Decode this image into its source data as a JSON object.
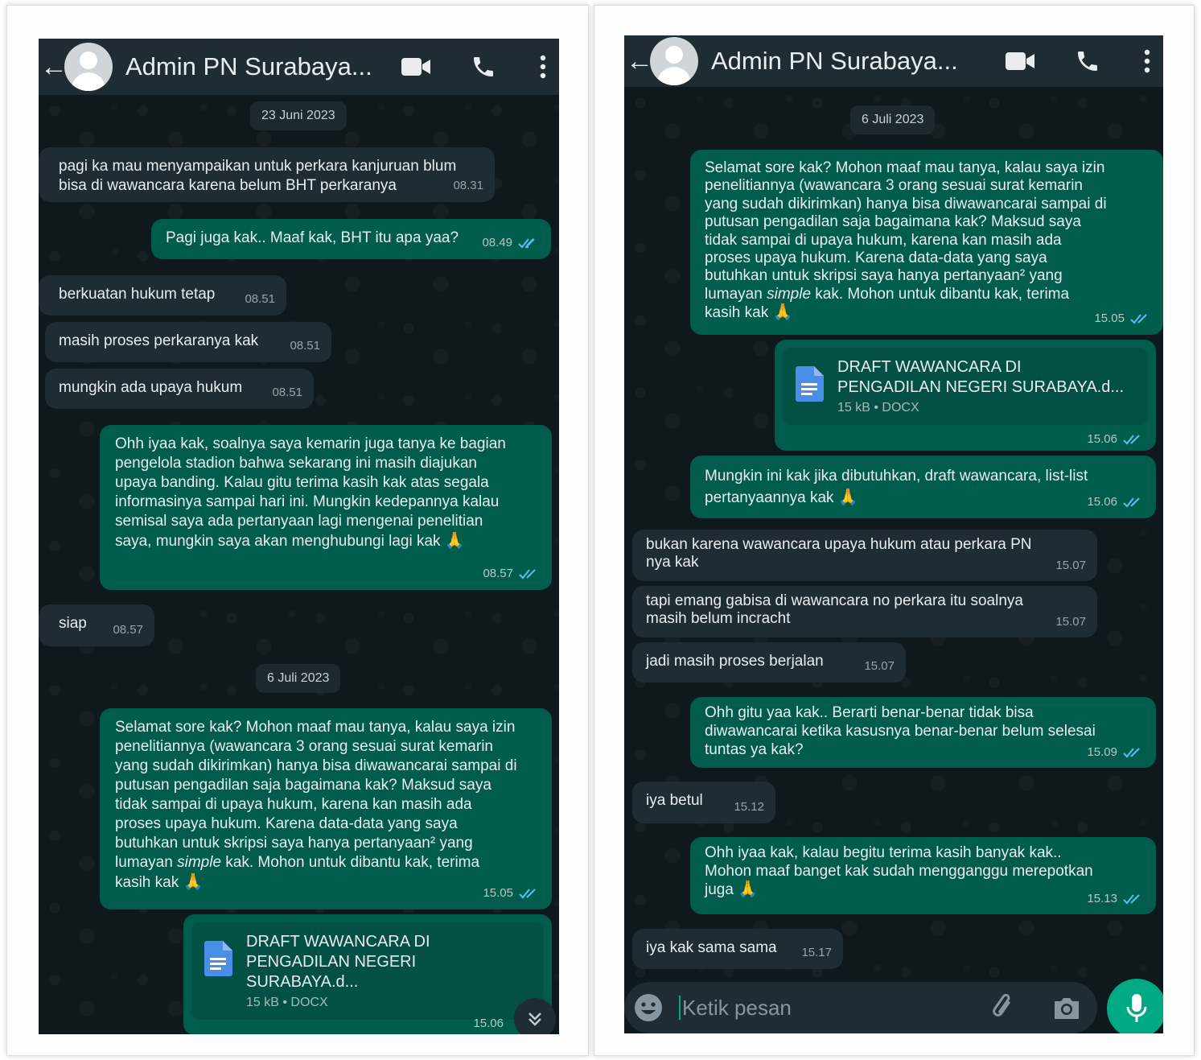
{
  "colors": {
    "header_bg": "#1f2c34",
    "chat_bg": "#0b141a",
    "bubble_in": "#1f2c34",
    "bubble_out": "#005c4b",
    "accent": "#00a884",
    "read_tick": "#53bdeb"
  },
  "left": {
    "header": {
      "title": "Admin PN Surabaya..."
    },
    "dates": [
      "23 Juni 2023",
      "6 Juli 2023"
    ],
    "messages": [
      {
        "text": "pagi ka mau menyampaikan untuk perkara kanjuruan blum\nbisa di wawancara karena belum BHT perkaranya",
        "time": "08.31"
      },
      {
        "text": "Pagi juga kak.. Maaf kak, BHT itu apa yaa?",
        "time": "08.49"
      },
      {
        "text": "berkuatan hukum tetap",
        "time": "08.51"
      },
      {
        "text": "masih proses perkaranya kak",
        "time": "08.51"
      },
      {
        "text": "mungkin ada upaya hukum",
        "time": "08.51"
      },
      {
        "text": "Ohh iyaa kak, soalnya saya kemarin juga tanya ke bagian\npengelola stadion bahwa sekarang ini masih diajukan\nupaya banding. Kalau gitu terima kasih kak atas segala\ninformasinya sampai hari ini. Mungkin kedepannya kalau\nsemisal saya ada pertanyaan lagi mengenai penelitian\nsaya, mungkin saya akan menghubungi lagi kak",
        "emoji": "🙏",
        "time": "08.57"
      },
      {
        "text": "siap",
        "time": "08.57"
      },
      {
        "text": "Selamat sore kak? Mohon maaf mau tanya, kalau saya izin\npenelitiannya (wawancara 3 orang sesuai surat kemarin\nyang sudah dikirimkan) hanya bisa diwawancarai sampai di\nputusan pengadilan saja bagaimana kak? Maksud saya\ntidak sampai di upaya hukum, karena kan masih ada\nproses upaya hukum. Karena data-data yang saya\nbutuhkan untuk skripsi saya hanya pertanyaan² yang\nlumayan ",
        "italic": "simple",
        "text_after": " kak. Mohon untuk dibantu kak, terima\nkasih kak",
        "emoji": "🙏",
        "time": "15.05"
      }
    ],
    "document": {
      "name_line1": "DRAFT WAWANCARA DI",
      "name_line2": "PENGADILAN NEGERI SURABAYA.d...",
      "info": "15 kB • DOCX",
      "time": "15.06"
    }
  },
  "right": {
    "header": {
      "title": "Admin PN Surabaya..."
    },
    "dates": [
      "6 Juli 2023"
    ],
    "messages": [
      {
        "text": "Selamat sore kak? Mohon maaf mau tanya, kalau saya izin\npenelitiannya (wawancara 3 orang sesuai surat kemarin\nyang sudah dikirimkan) hanya bisa diwawancarai sampai di\nputusan pengadilan saja bagaimana kak? Maksud saya\ntidak sampai di upaya hukum, karena kan masih ada\nproses upaya hukum. Karena data-data yang saya\nbutuhkan untuk skripsi saya hanya pertanyaan² yang\nlumayan ",
        "italic": "simple",
        "text_after": " kak. Mohon untuk dibantu kak, terima\nkasih kak",
        "emoji": "🙏",
        "time": "15.05"
      },
      {
        "text": "Mungkin ini kak jika dibutuhkan, draft wawancara, list-list\npertanyaannya kak",
        "emoji": "🙏",
        "time": "15.06"
      },
      {
        "text": "bukan karena wawancara upaya hukum atau perkara PN\nnya kak",
        "time": "15.07"
      },
      {
        "text": "tapi emang gabisa di wawancara no perkara itu soalnya\nmasih belum incracht",
        "time": "15.07"
      },
      {
        "text": "jadi masih proses berjalan",
        "time": "15.07"
      },
      {
        "text": "Ohh gitu yaa kak.. Berarti benar-benar tidak bisa\ndiwawancarai ketika kasusnya benar-benar belum selesai\ntuntas ya kak?",
        "time": "15.09"
      },
      {
        "text": "iya betul",
        "time": "15.12"
      },
      {
        "text": "Ohh iyaa kak, kalau begitu terima kasih banyak kak..\nMohon maaf banget kak sudah mengganggu merepotkan\njuga",
        "emoji": "🙏",
        "time": "15.13"
      },
      {
        "text": "iya kak sama sama",
        "time": "15.17"
      }
    ],
    "document": {
      "name_line1": "DRAFT WAWANCARA DI",
      "name_line2": "PENGADILAN NEGERI SURABAYA.d...",
      "info": "15 kB • DOCX",
      "time": "15.06"
    },
    "input": {
      "placeholder": "Ketik pesan"
    }
  }
}
